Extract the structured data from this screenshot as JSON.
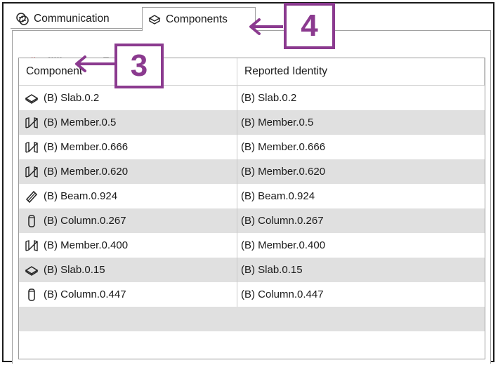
{
  "tabs": [
    {
      "label": "Communication",
      "icon": "communication-icon",
      "active": false
    },
    {
      "label": "Components",
      "icon": "components-icon",
      "active": true
    }
  ],
  "toolbar": {
    "buttons": [
      {
        "icon": "remove-component-icon",
        "enabled": true
      },
      {
        "icon": "add-component-icon",
        "enabled": true
      },
      {
        "icon": "remove-from-view-icon",
        "enabled": true
      },
      {
        "icon": "delete-icon",
        "enabled": false
      }
    ]
  },
  "table": {
    "columns": [
      "Component",
      "Reported Identity"
    ],
    "rows": [
      {
        "icon": "slab-icon",
        "component": "(B) Slab.0.2",
        "identity": "(B) Slab.0.2"
      },
      {
        "icon": "member-icon",
        "component": "(B) Member.0.5",
        "identity": "(B) Member.0.5"
      },
      {
        "icon": "member-icon",
        "component": "(B) Member.0.666",
        "identity": "(B) Member.0.666"
      },
      {
        "icon": "member-icon",
        "component": "(B) Member.0.620",
        "identity": "(B) Member.0.620"
      },
      {
        "icon": "beam-icon",
        "component": "(B) Beam.0.924",
        "identity": "(B) Beam.0.924"
      },
      {
        "icon": "column-icon",
        "component": "(B) Column.0.267",
        "identity": "(B) Column.0.267"
      },
      {
        "icon": "member-icon",
        "component": "(B) Member.0.400",
        "identity": "(B) Member.0.400"
      },
      {
        "icon": "slab-icon",
        "component": "(B) Slab.0.15",
        "identity": "(B) Slab.0.15"
      },
      {
        "icon": "column-icon",
        "component": "(B) Column.0.447",
        "identity": "(B) Column.0.447"
      }
    ]
  },
  "callouts": {
    "step3": "3",
    "step4": "4"
  },
  "colors": {
    "callout": "#8b3a8f",
    "row_alt": "#e0e0e0"
  }
}
